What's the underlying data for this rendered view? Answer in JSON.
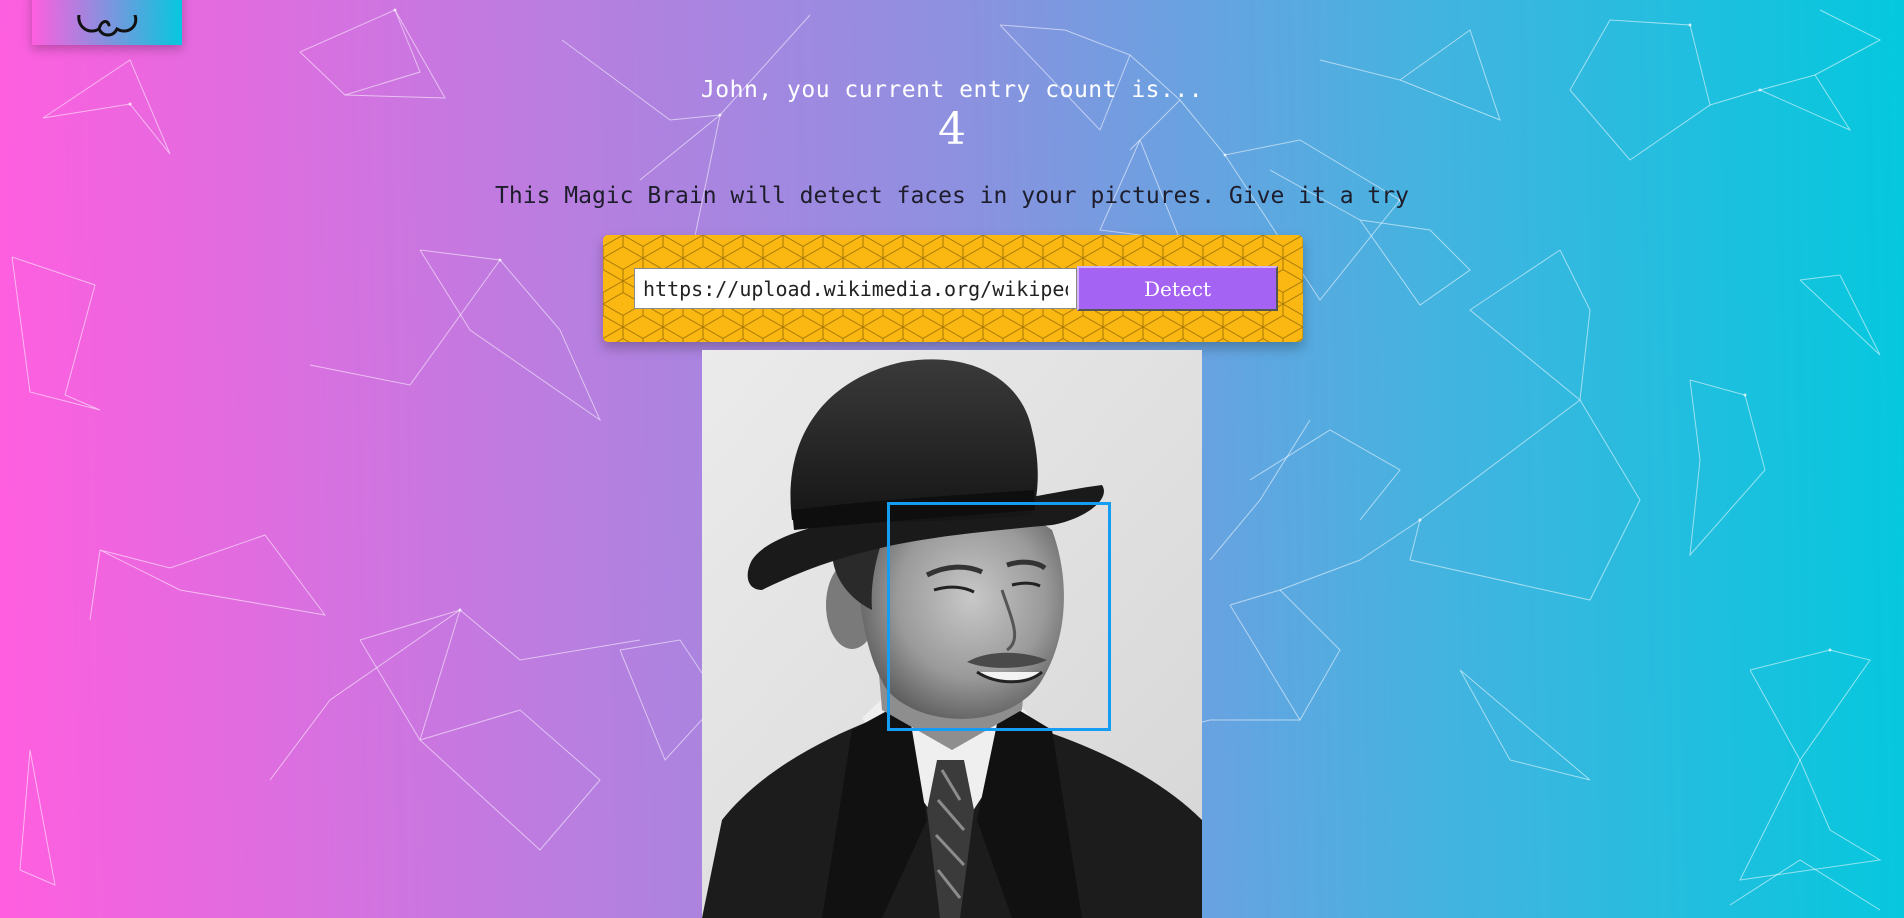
{
  "navigation": {
    "logo_icon": "brain-icon"
  },
  "rank": {
    "message": "John, you current entry count is...",
    "count": "4"
  },
  "intro": {
    "text": "This Magic Brain will detect faces in your pictures. Give it a try"
  },
  "image_link_form": {
    "input_value": "https://upload.wikimedia.org/wikipedia/commons/image.jpg",
    "button_label": "Detect"
  },
  "face_recognition": {
    "image_description_icon": "portrait-photo",
    "face_count": 1
  },
  "colors": {
    "gradient_start": "#ff5edf",
    "gradient_end": "#04c8de",
    "panel_yellow": "#fbb812",
    "button_purple": "#a463f2",
    "face_box_blue": "#149df2"
  }
}
